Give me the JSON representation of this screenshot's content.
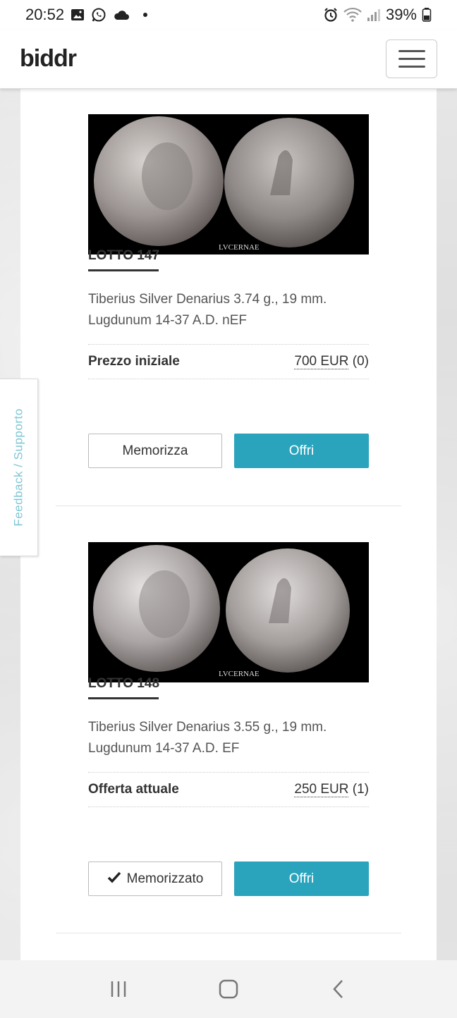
{
  "status_bar": {
    "time": "20:52",
    "battery": "39%",
    "icons_left": [
      "gallery-icon",
      "whatsapp-icon",
      "cloud-icon",
      "notification-dot"
    ],
    "icons_right": [
      "alarm-icon",
      "wifi-icon",
      "signal-icon",
      "battery-icon"
    ]
  },
  "header": {
    "logo": "biddr",
    "menu_icon": "hamburger-icon"
  },
  "feedback_tab": {
    "label": "Feedback / Supporto"
  },
  "lots": [
    {
      "title": "LOTTO 147",
      "description": "Tiberius Silver Denarius 3.74 g., 19 mm. Lugdunum 14-37 A.D. nEF",
      "price_label": "Prezzo iniziale",
      "price_amount": "700 EUR",
      "price_count": "(0)",
      "save_label": "Memorizza",
      "saved": false,
      "offer_label": "Offri",
      "image_watermark": "LVCERNAE"
    },
    {
      "title": "LOTTO 148",
      "description": "Tiberius Silver Denarius 3.55 g., 19 mm. Lugdunum 14-37 A.D. EF",
      "price_label": "Offerta attuale",
      "price_amount": "250 EUR",
      "price_count": "(1)",
      "save_label": "Memorizzato",
      "saved": true,
      "offer_label": "Offri",
      "image_watermark": "LVCERNAE"
    }
  ],
  "colors": {
    "accent": "#2aa4bd",
    "feedback_text": "#7fc6d4"
  },
  "nav_bar": {
    "icons": [
      "recent-apps-icon",
      "home-icon",
      "back-icon"
    ]
  }
}
